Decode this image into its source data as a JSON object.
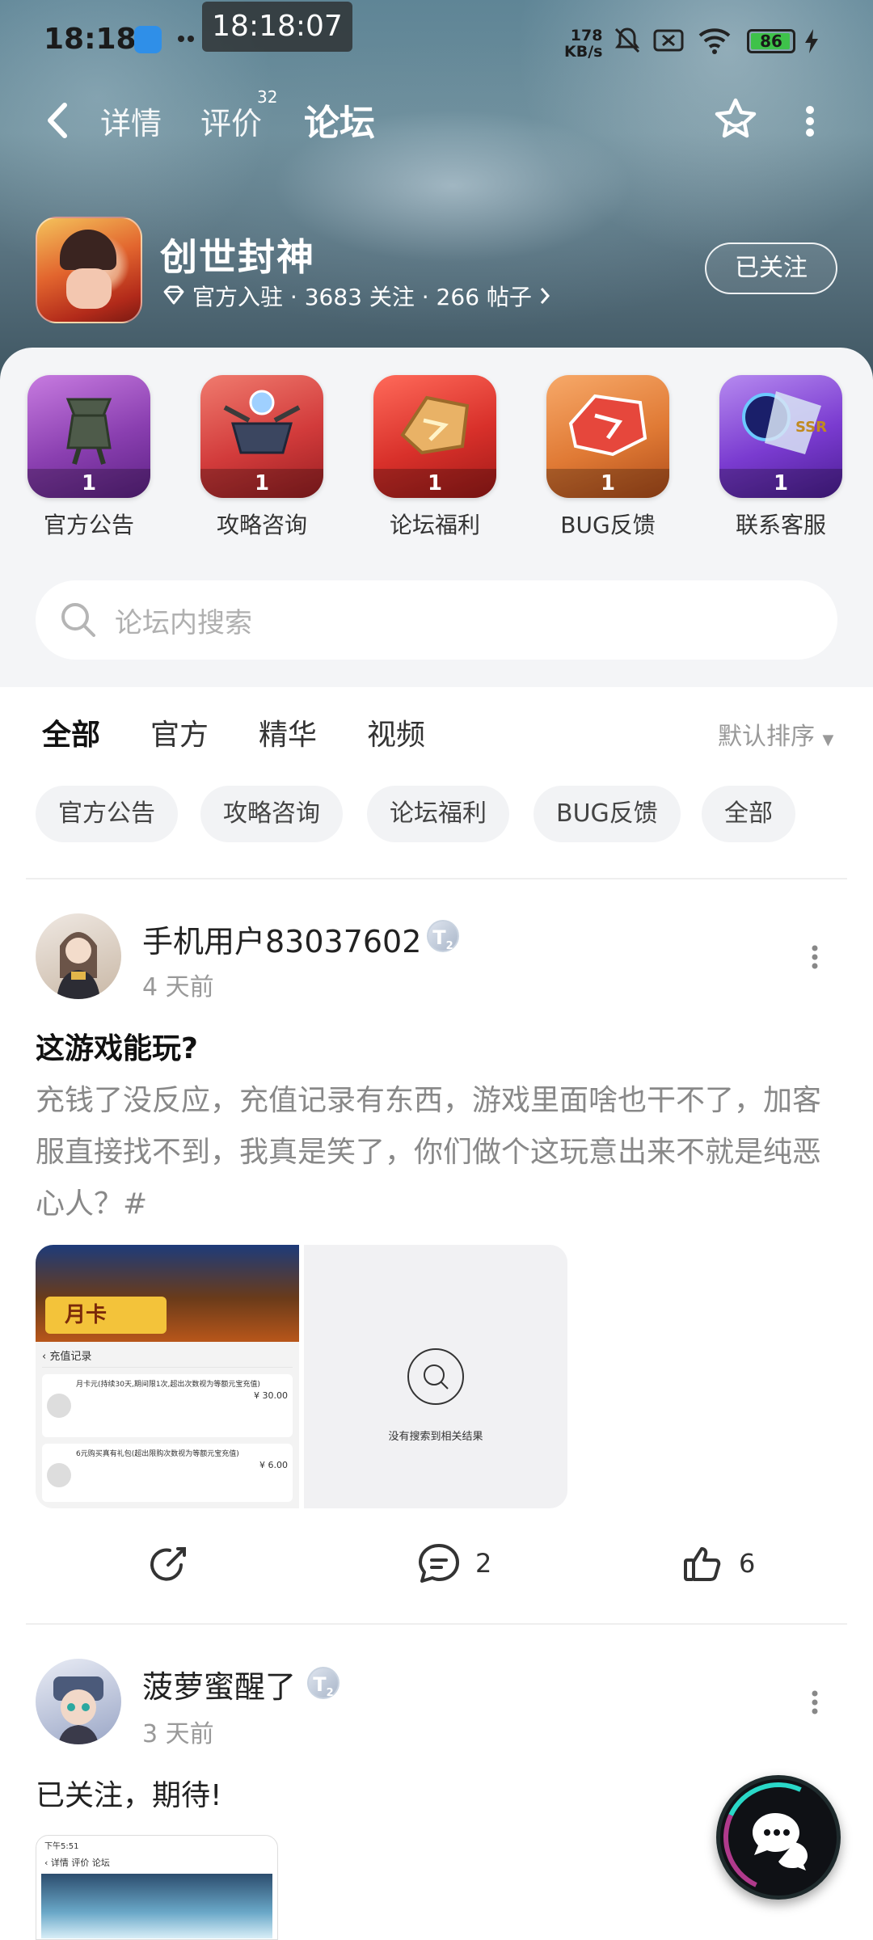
{
  "status_bar": {
    "time": "18:18",
    "clock_overlay": "18:18:07",
    "net_speed_value": "178",
    "net_speed_unit": "KB/s",
    "battery": "86"
  },
  "nav": {
    "tabs": [
      {
        "label": "详情"
      },
      {
        "label": "评价",
        "badge": "32"
      },
      {
        "label": "论坛"
      }
    ],
    "active_tab": "论坛"
  },
  "game": {
    "name": "创世封神",
    "meta": "官方入驻 · 3683 关注 · 266 帖子",
    "follow_label": "已关注"
  },
  "categories": [
    {
      "label": "官方公告",
      "count": "1",
      "color": "#8a3fb0"
    },
    {
      "label": "攻略咨询",
      "count": "1",
      "color": "#d23b3b"
    },
    {
      "label": "论坛福利",
      "count": "1",
      "color": "#d8302a"
    },
    {
      "label": "BUG反馈",
      "count": "1",
      "color": "#e07a35"
    },
    {
      "label": "联系客服",
      "count": "1",
      "color": "#7a3bd0"
    }
  ],
  "search": {
    "placeholder": "论坛内搜索"
  },
  "feed_tabs": [
    "全部",
    "官方",
    "精华",
    "视频"
  ],
  "sort_label": "默认排序",
  "chips": [
    "官方公告",
    "攻略咨询",
    "论坛福利",
    "BUG反馈",
    "全部"
  ],
  "posts": [
    {
      "username": "手机用户83037602",
      "level": "T",
      "level_sub": "2",
      "time": "4 天前",
      "title": "这游戏能玩?",
      "body": "充钱了没反应，充值记录有东西，游戏里面啥也干不了，加客服直接找不到，我真是笑了，你们做个这玩意出来不就是纯恶心人？#",
      "image1": {
        "header": "充值记录",
        "month_card": "月卡",
        "row1_text": "月卡元(持续30天,期间限1次,超出次数视为等额元宝充值)",
        "row1_price": "¥ 30.00",
        "row2_text": "6元购买真有礼包(超出限购次数视为等额元宝充值)",
        "row2_price": "¥ 6.00"
      },
      "image2": {
        "empty_text": "没有搜索到相关结果"
      },
      "comments": "2",
      "likes": "6"
    },
    {
      "username": "菠萝蜜醒了",
      "level": "T",
      "level_sub": "2",
      "time": "3 天前",
      "title": "已关注，期待!",
      "thumb": {
        "time": "下午5:51",
        "tabs": "详情 评价 论坛"
      }
    }
  ],
  "colors": {
    "accent": "#23d4c4",
    "hero_bg": "#6e8f9c"
  }
}
